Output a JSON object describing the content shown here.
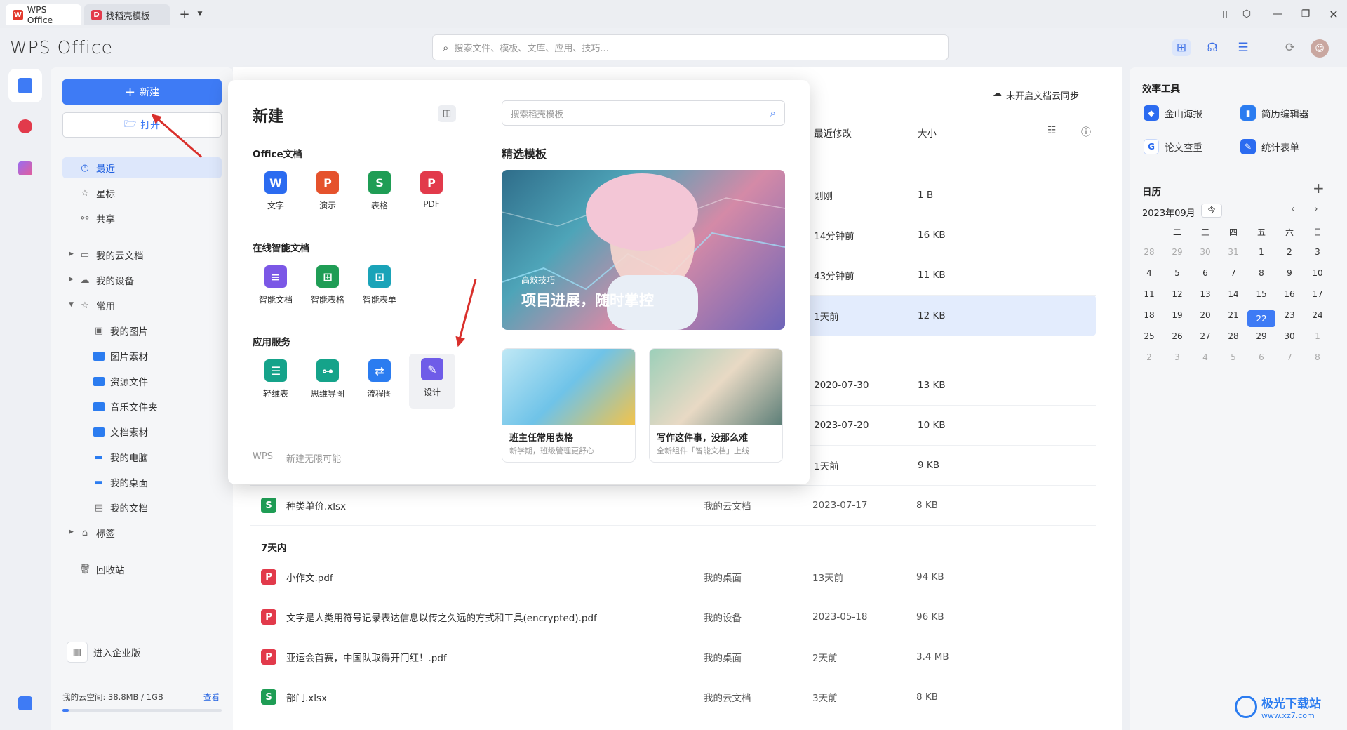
{
  "tabs": [
    {
      "label": "WPS Office"
    },
    {
      "label": "找稻壳模板"
    }
  ],
  "brand": "WPS Office",
  "search": {
    "placeholder": "搜索文件、模板、文库、应用、技巧..."
  },
  "left": {
    "new_label": "新建",
    "open_label": "打开",
    "nav": [
      {
        "label": "最近"
      },
      {
        "label": "星标"
      },
      {
        "label": "共享"
      },
      {
        "label": "我的云文档"
      },
      {
        "label": "我的设备"
      },
      {
        "label": "常用"
      },
      {
        "label": "我的图片"
      },
      {
        "label": "图片素材"
      },
      {
        "label": "资源文件"
      },
      {
        "label": "音乐文件夹"
      },
      {
        "label": "文档素材"
      },
      {
        "label": "我的电脑"
      },
      {
        "label": "我的桌面"
      },
      {
        "label": "我的文档"
      },
      {
        "label": "标签"
      },
      {
        "label": "回收站"
      }
    ],
    "enterprise_label": "进入企业版",
    "storage_label": "我的云空间: 38.8MB / 1GB",
    "storage_link": "查看",
    "storage_fraction": 0.038
  },
  "main": {
    "cloud_sync": "未开启文档云同步",
    "columns": {
      "modified": "最近修改",
      "size": "大小"
    },
    "top_rows": [
      {
        "time": "刚刚",
        "size": "1 B"
      },
      {
        "time": "14分钟前",
        "size": "16 KB"
      },
      {
        "time": "43分钟前",
        "size": "11 KB"
      },
      {
        "time": "1天前",
        "size": "12 KB"
      },
      {
        "time": "2020-07-30",
        "size": "13 KB"
      },
      {
        "time": "2023-07-20",
        "size": "10 KB"
      },
      {
        "time": "1天前",
        "size": "9 KB"
      }
    ],
    "rows": [
      {
        "icon": "S",
        "type": "xls",
        "name": "种类单价.xlsx",
        "location": "我的云文档",
        "time": "2023-07-17",
        "size": "8 KB"
      }
    ],
    "group_7days": "7天内",
    "rows7": [
      {
        "icon": "P",
        "type": "pdf",
        "name": "小作文.pdf",
        "location": "我的桌面",
        "time": "13天前",
        "size": "94 KB"
      },
      {
        "icon": "P",
        "type": "pdf",
        "name": "文字是人类用符号记录表达信息以传之久远的方式和工具(encrypted).pdf",
        "location": "我的设备",
        "time": "2023-05-18",
        "size": "96 KB"
      },
      {
        "icon": "P",
        "type": "pdf",
        "name": "亚运会首赛，中国队取得开门红！.pdf",
        "location": "我的桌面",
        "time": "2天前",
        "size": "3.4 MB"
      },
      {
        "icon": "S",
        "type": "xls",
        "name": "部门.xlsx",
        "location": "我的云文档",
        "time": "3天前",
        "size": "8 KB"
      }
    ]
  },
  "popup": {
    "title": "新建",
    "search_placeholder": "搜索稻壳模板",
    "office_section": "Office文档",
    "office_apps": [
      {
        "label": "文字",
        "glyph": "W",
        "color": "#2b6bf0"
      },
      {
        "label": "演示",
        "glyph": "P",
        "color": "#e5522c"
      },
      {
        "label": "表格",
        "glyph": "S",
        "color": "#1f9d55"
      },
      {
        "label": "PDF",
        "glyph": "P",
        "color": "#e23a4b"
      }
    ],
    "online_section": "在线智能文档",
    "online_apps": [
      {
        "label": "智能文档",
        "glyph": "≡",
        "color": "#7b57e6"
      },
      {
        "label": "智能表格",
        "glyph": "⊞",
        "color": "#1f9d55"
      },
      {
        "label": "智能表单",
        "glyph": "⊡",
        "color": "#1aa3b8"
      }
    ],
    "services_section": "应用服务",
    "service_apps": [
      {
        "label": "轻维表",
        "glyph": "☰",
        "color": "#15a38a"
      },
      {
        "label": "思维导图",
        "glyph": "⊶",
        "color": "#15a38a"
      },
      {
        "label": "流程图",
        "glyph": "⇄",
        "color": "#2b7cf0"
      },
      {
        "label": "设计",
        "glyph": "✎",
        "color": "#6f5ce8"
      }
    ],
    "footer_brand": "WPS",
    "footer_slogan": "新建无限可能",
    "featured_title": "精选模板",
    "banner_tag": "高效技巧",
    "banner_title": "项目进展，随时掌控",
    "cards": [
      {
        "title": "班主任常用表格",
        "subtitle": "新学期，班级管理更舒心"
      },
      {
        "title": "写作这件事，没那么难",
        "subtitle": "全新组件「智能文档」上线"
      }
    ]
  },
  "right": {
    "tools_title": "效率工具",
    "tools": [
      {
        "label": "金山海报",
        "color": "#2b6bf0"
      },
      {
        "label": "简历编辑器",
        "color": "#2b7cf0"
      },
      {
        "label": "论文查重",
        "color": "#2b6bf0"
      },
      {
        "label": "统计表单",
        "color": "#2b6bf0"
      }
    ],
    "calendar_title": "日历",
    "month": "2023年09月",
    "today_btn": "今",
    "weekdays": [
      "一",
      "二",
      "三",
      "四",
      "五",
      "六",
      "日"
    ],
    "days": [
      [
        28,
        29,
        30,
        31,
        1,
        2,
        3
      ],
      [
        4,
        5,
        6,
        7,
        8,
        9,
        10
      ],
      [
        11,
        12,
        13,
        14,
        15,
        16,
        17
      ],
      [
        18,
        19,
        20,
        21,
        22,
        23,
        24
      ],
      [
        25,
        26,
        27,
        28,
        29,
        30,
        1
      ],
      [
        2,
        3,
        4,
        5,
        6,
        7,
        8
      ]
    ],
    "today": 22
  },
  "watermark": "极光下载站",
  "watermark_url": "www.xz7.com"
}
